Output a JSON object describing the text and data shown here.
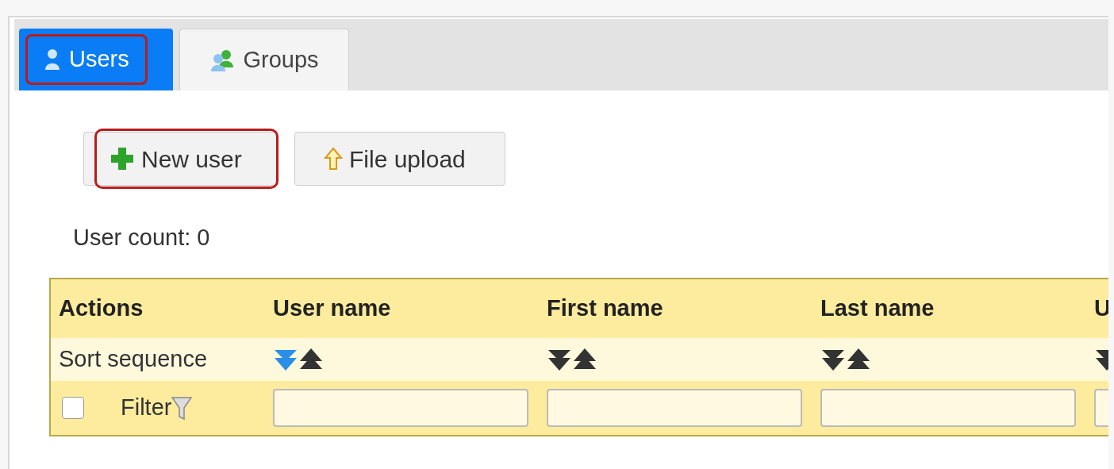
{
  "tabs": [
    {
      "label": "Users",
      "kind": "user",
      "selected": true,
      "highlighted": true
    },
    {
      "label": "Groups",
      "kind": "group",
      "selected": false,
      "highlighted": false
    }
  ],
  "toolbar": [
    {
      "label": "New user",
      "kind": "plus",
      "highlighted": true
    },
    {
      "label": "File upload",
      "kind": "upload",
      "highlighted": false
    }
  ],
  "user_count": "User count: 0",
  "table": {
    "actions_header": "Actions",
    "sort_label": "Sort sequence",
    "filter_label": "Filter",
    "select_all_checked": false,
    "columns": [
      {
        "header": "User name",
        "sort_desc_active": true
      },
      {
        "header": "First name",
        "sort_desc_active": false
      },
      {
        "header": "Last name",
        "sort_desc_active": false
      },
      {
        "header": "U",
        "sort_desc_active": false
      }
    ]
  }
}
